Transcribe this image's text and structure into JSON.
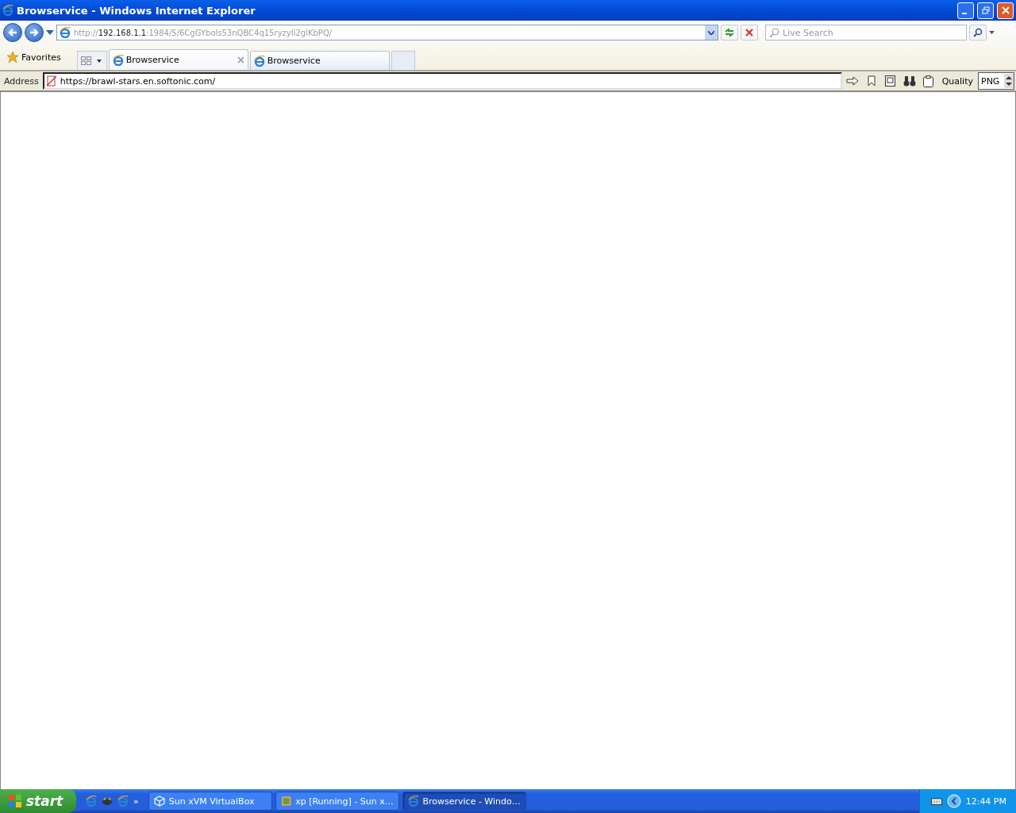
{
  "window": {
    "title": "Browservice - Windows Internet Explorer"
  },
  "navigation": {
    "url_scheme": "http://",
    "url_host": "192.168.1.1",
    "url_rest": ":1984/5/6CgGYbols53nQBC4q15ryzyIi2glKbPQ/",
    "search_placeholder": "Live Search"
  },
  "favorites": {
    "label": "Favorites"
  },
  "tabs": [
    {
      "label": "Browservice",
      "selected": true
    },
    {
      "label": "Browservice",
      "selected": false
    }
  ],
  "address_bar": {
    "label": "Address",
    "url": "https://brawl-stars.en.softonic.com/",
    "quality_label": "Quality",
    "quality_value": "PNG"
  },
  "taskbar": {
    "start": "start",
    "tasks": [
      {
        "label": "Sun xVM VirtualBox",
        "selected": false,
        "kind": "cube"
      },
      {
        "label": "xp [Running] - Sun x…",
        "selected": false,
        "kind": "app"
      },
      {
        "label": "Browservice - Windo…",
        "selected": true,
        "kind": "browser"
      }
    ],
    "clock": "12:44 PM",
    "overflow": "»"
  }
}
